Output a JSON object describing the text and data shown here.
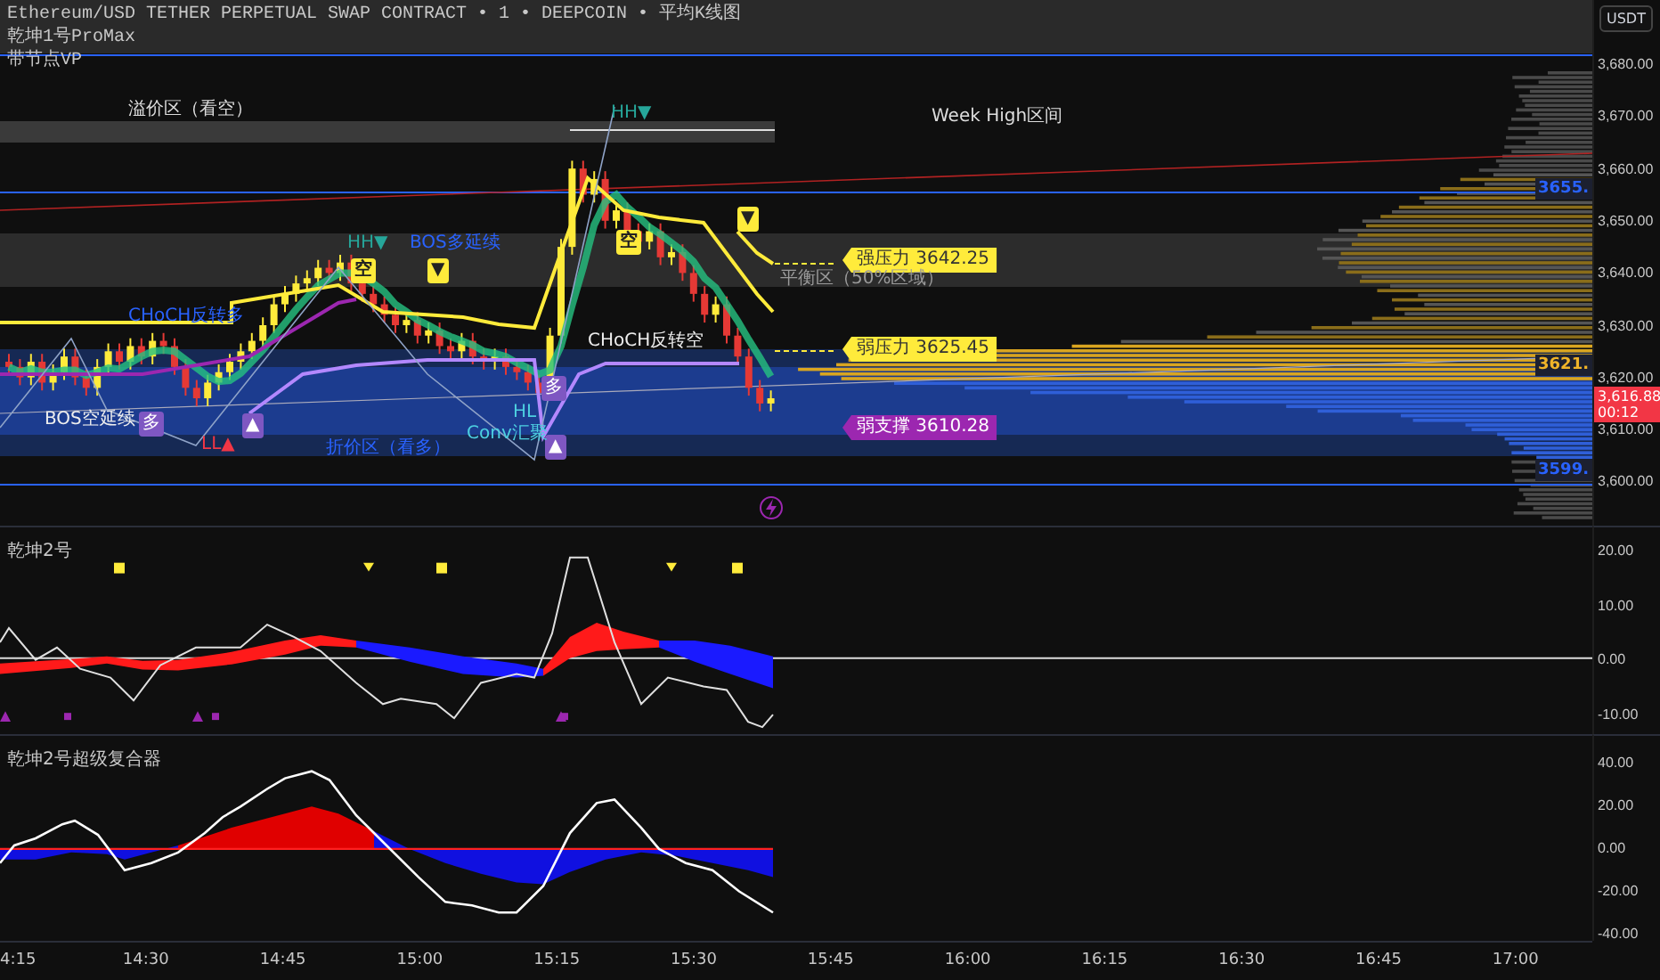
{
  "legend": {
    "title": "Ethereum/USD TETHER PERPETUAL SWAP CONTRACT • 1 • DEEPCOIN • 平均K线图",
    "indicators": [
      "乾坤1号ProMax",
      "带节点VP"
    ]
  },
  "main_pane": {
    "annotations": [
      {
        "text": "溢价区（看空）",
        "kind": "label",
        "color": "#dddddd"
      },
      {
        "text": "HH▼",
        "kind": "label",
        "color": "#26a69a"
      },
      {
        "text": "Week High区间",
        "kind": "label",
        "color": "#dddddd"
      },
      {
        "text": "HH▼",
        "kind": "label",
        "color": "#26a69a"
      },
      {
        "text": "BOS多延续",
        "kind": "label",
        "color": "#2962ff"
      },
      {
        "text": "空",
        "kind": "badge_sell"
      },
      {
        "text": "空",
        "kind": "badge_sell"
      },
      {
        "text": "▼",
        "kind": "badge_sell"
      },
      {
        "text": "▼",
        "kind": "badge_sell"
      },
      {
        "text": "强压力 3642.25",
        "kind": "tag_yellow"
      },
      {
        "text": "平衡区（50%区域）",
        "kind": "label",
        "color": "#9a9a9a"
      },
      {
        "text": "CHoCH反转空",
        "kind": "label",
        "color": "#eeeeee"
      },
      {
        "text": "CHoCH反转多",
        "kind": "label",
        "color": "#2962ff"
      },
      {
        "text": "弱压力 3625.45",
        "kind": "tag_yellow"
      },
      {
        "text": "多",
        "kind": "badge_buy"
      },
      {
        "text": "▲",
        "kind": "badge_buy"
      },
      {
        "text": "多",
        "kind": "badge_buy"
      },
      {
        "text": "▲",
        "kind": "badge_buy"
      },
      {
        "text": "BOS空延续",
        "kind": "label",
        "color": "#eeeeee"
      },
      {
        "text": "LL▲",
        "kind": "label",
        "color": "#f23645"
      },
      {
        "text": "折价区（看多）",
        "kind": "label",
        "color": "#2962ff"
      },
      {
        "text": "HL",
        "kind": "label",
        "color": "#4dd0e1"
      },
      {
        "text": "Conv汇聚",
        "kind": "label",
        "color": "#4dd0e1"
      },
      {
        "text": "弱支撑 3610.28",
        "kind": "tag_purple"
      }
    ],
    "level_markers": [
      {
        "text": "3655.",
        "color": "#2962ff"
      },
      {
        "text": "3621.",
        "color": "#f0b429"
      },
      {
        "text": "3599.",
        "color": "#2962ff"
      }
    ],
    "price_axis": {
      "currency": "USDT",
      "ticks": [
        "3,680.00",
        "3,670.00",
        "3,660.00",
        "3,650.00",
        "3,640.00",
        "3,630.00",
        "3,620.00",
        "3,610.00",
        "3,600.00"
      ],
      "current_price": "3,616.88",
      "countdown": "00:12"
    }
  },
  "oscillator_pane": {
    "title": "乾坤2号",
    "ticks": [
      "20.00",
      "10.00",
      "0.00",
      "-10.00"
    ]
  },
  "composite_pane": {
    "title": "乾坤2号超级复合器",
    "ticks": [
      "40.00",
      "20.00",
      "0.00",
      "-20.00",
      "-40.00"
    ]
  },
  "time_axis": {
    "ticks": [
      "4:15",
      "14:30",
      "14:45",
      "15:00",
      "15:15",
      "15:30",
      "15:45",
      "16:00",
      "16:15",
      "16:30",
      "16:45",
      "17:00"
    ]
  }
}
